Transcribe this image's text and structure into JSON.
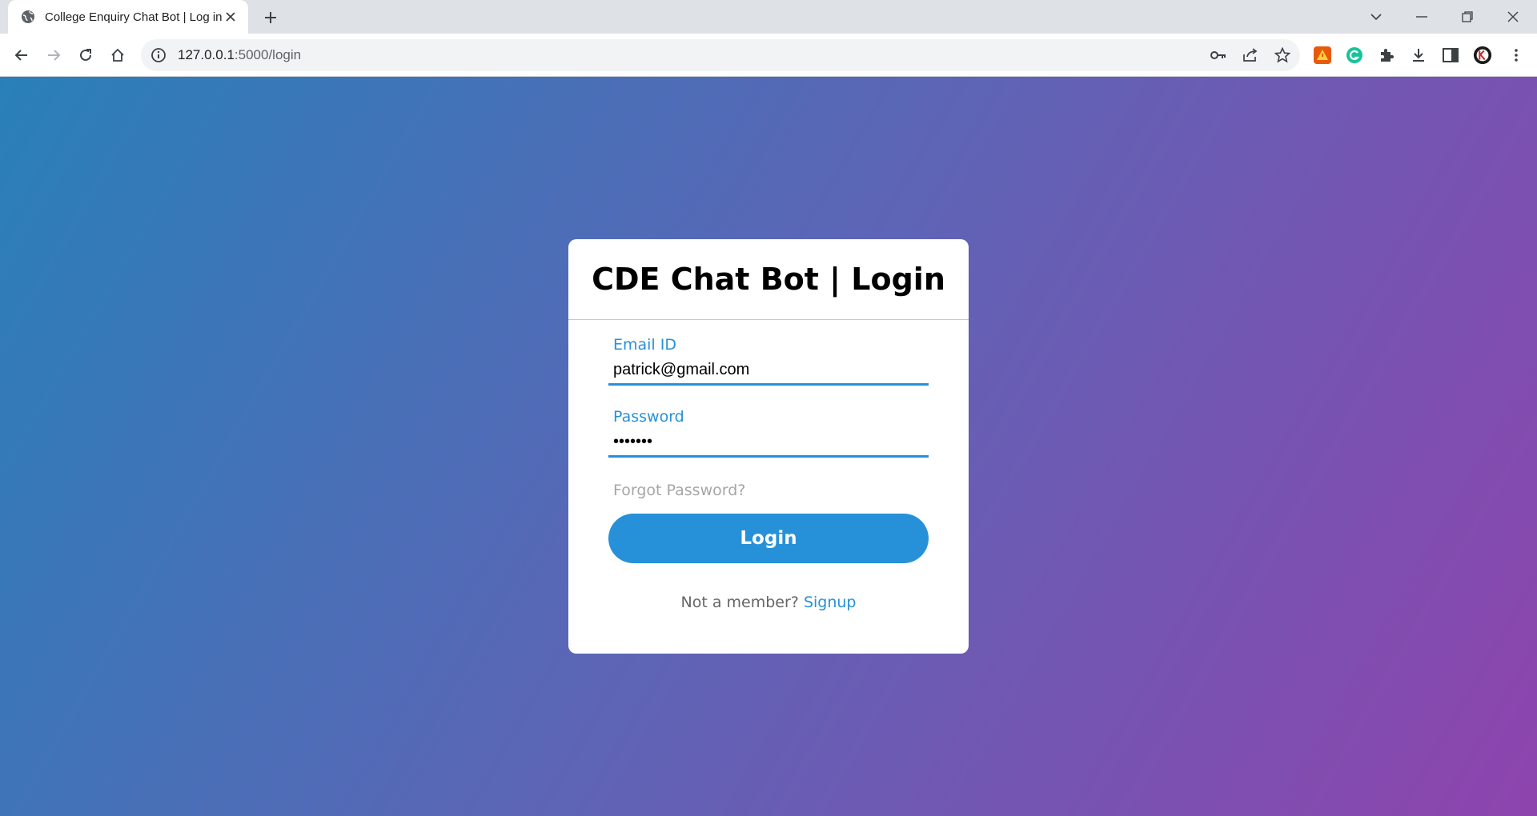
{
  "browser": {
    "tab_title": "College Enquiry Chat Bot | Log in",
    "url_host": "127.0.0.1",
    "url_path": ":5000/login"
  },
  "card": {
    "title": "CDE Chat Bot | Login",
    "email": {
      "label": "Email ID",
      "value": "patrick@gmail.com"
    },
    "password": {
      "label": "Password",
      "value": "•••••••"
    },
    "forgot_link": "Forgot Password?",
    "login_button": "Login",
    "signup_prompt": "Not a member?",
    "signup_link": "Signup"
  },
  "colors": {
    "accent": "#2691d9",
    "gradient_start": "#2980b9",
    "gradient_end": "#8e44ad"
  }
}
